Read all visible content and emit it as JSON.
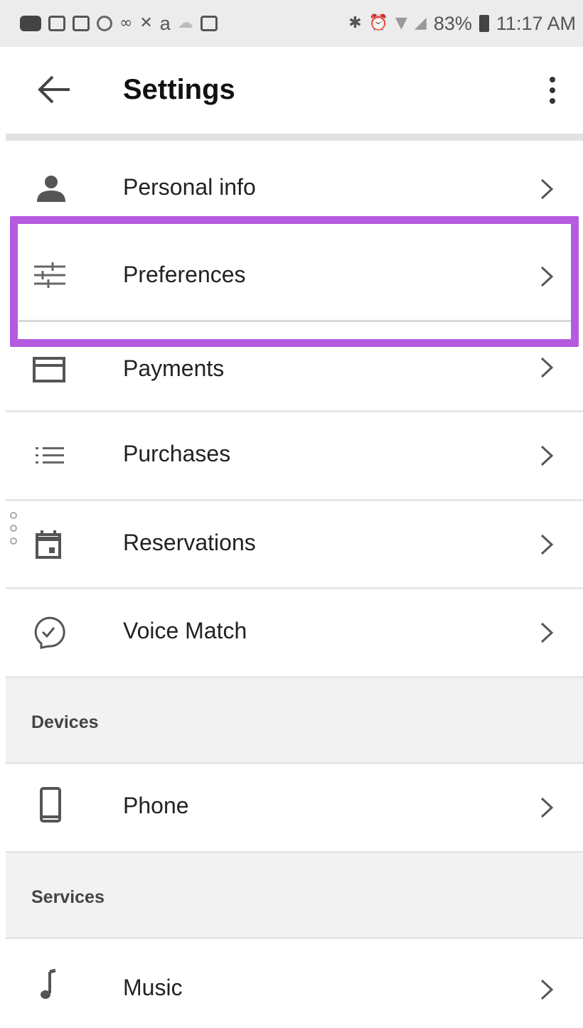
{
  "status_bar": {
    "battery": "83%",
    "time": "11:17 AM",
    "left_icons": [
      "message-icon",
      "gallery-icon",
      "gallery-icon",
      "messenger-icon",
      "voicemail-icon",
      "missed-call-icon",
      "amazon-icon",
      "cloud-icon",
      "image-icon"
    ],
    "amazon_glyph": "a",
    "right_icons": [
      "bluetooth-icon",
      "alarm-icon",
      "wifi-icon",
      "signal-icon",
      "battery-icon"
    ]
  },
  "app_bar": {
    "title": "Settings",
    "back_icon": "arrow-back-icon",
    "menu_icon": "more-vert-icon"
  },
  "rows": [
    {
      "label": "Personal info",
      "icon": "person-icon"
    },
    {
      "label": "Preferences",
      "icon": "tune-icon",
      "highlighted": true
    },
    {
      "label": "Payments",
      "icon": "credit-card-icon"
    },
    {
      "label": "Purchases",
      "icon": "list-icon"
    },
    {
      "label": "Reservations",
      "icon": "calendar-icon"
    },
    {
      "label": "Voice Match",
      "icon": "voice-match-icon"
    }
  ],
  "sections": [
    {
      "title": "Devices",
      "rows": [
        {
          "label": "Phone",
          "icon": "phone-icon"
        }
      ]
    },
    {
      "title": "Services",
      "rows": [
        {
          "label": "Music",
          "icon": "music-note-icon"
        }
      ]
    }
  ],
  "colors": {
    "highlight": "#b55be0",
    "section_bg": "#f2f2f2",
    "status_bg": "#ececec"
  }
}
